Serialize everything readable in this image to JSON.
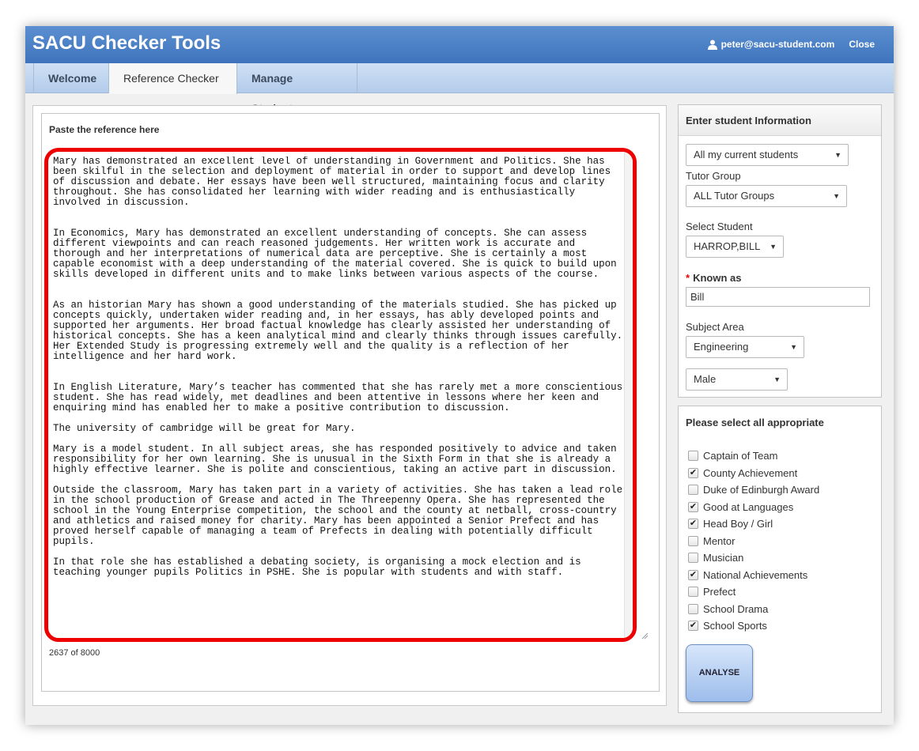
{
  "header": {
    "title": "SACU Checker Tools",
    "user_email": "peter@sacu-student.com",
    "close_label": "Close"
  },
  "tabs": [
    {
      "label": "Welcome",
      "active": false
    },
    {
      "label": "Reference Checker",
      "active": true
    },
    {
      "label": "Manage Students",
      "active": false
    }
  ],
  "reference": {
    "label": "Paste the reference here",
    "text": "Mary has demonstrated an excellent level of understanding in Government and Politics. She has\nbeen skilful in the selection and deployment of material in order to support and develop lines\nof discussion and debate. Her essays have been well structured, maintaining focus and clarity\nthroughout. She has consolidated her learning with wider reading and is enthusiastically\ninvolved in discussion.\n\n\nIn Economics, Mary has demonstrated an excellent understanding of concepts. She can assess\ndifferent viewpoints and can reach reasoned judgements. Her written work is accurate and\nthorough and her interpretations of numerical data are perceptive. She is certainly a most\ncapable economist with a deep understanding of the material covered. She is quick to build upon\nskills developed in different units and to make links between various aspects of the course.\n\n\nAs an historian Mary has shown a good understanding of the materials studied. She has picked up\nconcepts quickly, undertaken wider reading and, in her essays, has ably developed points and\nsupported her arguments. Her broad factual knowledge has clearly assisted her understanding of\nhistorical concepts. She has a keen analytical mind and clearly thinks through issues carefully.\nHer Extended Study is progressing extremely well and the quality is a reflection of her\nintelligence and her hard work.\n\n\nIn English Literature, Mary’s teacher has commented that she has rarely met a more conscientious\nstudent. She has read widely, met deadlines and been attentive in lessons where her keen and\nenquiring mind has enabled her to make a positive contribution to discussion.\n\nThe university of cambridge will be great for Mary.\n\nMary is a model student. In all subject areas, she has responded positively to advice and taken\nresponsibility for her own learning. She is unusual in the Sixth Form in that she is already a\nhighly effective learner. She is polite and conscientious, taking an active part in discussion.\n\nOutside the classroom, Mary has taken part in a variety of activities. She has taken a lead role\nin the school production of Grease and acted in The Threepenny Opera. She has represented the\nschool in the Young Enterprise competition, the school and the county at netball, cross-country\nand athletics and raised money for charity. Mary has been appointed a Senior Prefect and has\nproved herself capable of managing a team of Prefects in dealing with potentially difficult\npupils.\n\nIn that role she has established a debating society, is organising a mock election and is\nteaching younger pupils Politics in PSHE. She is popular with students and with staff.",
    "char_count": "2637 of 8000"
  },
  "student_info": {
    "heading": "Enter student Information",
    "students_select": "All my current students",
    "tutor_group_label": "Tutor Group",
    "tutor_group_select": "ALL Tutor Groups",
    "select_student_label": "Select Student",
    "student_select": "HARROP,BILL",
    "required_mark": "*",
    "known_as_label": "Known as",
    "known_as_value": "Bill",
    "subject_area_label": "Subject Area",
    "subject_select": "Engineering",
    "gender_select": "Male",
    "arrow_glyph": "▼"
  },
  "appropriate": {
    "heading": "Please select all appropriate",
    "check_glyph": "✔",
    "items": [
      {
        "label": "Captain of Team",
        "checked": false
      },
      {
        "label": "County Achievement",
        "checked": true
      },
      {
        "label": "Duke of Edinburgh Award",
        "checked": false
      },
      {
        "label": "Good at Languages",
        "checked": true
      },
      {
        "label": "Head Boy / Girl",
        "checked": true
      },
      {
        "label": "Mentor",
        "checked": false
      },
      {
        "label": "Musician",
        "checked": false
      },
      {
        "label": "National Achievements",
        "checked": true
      },
      {
        "label": "Prefect",
        "checked": false
      },
      {
        "label": "School Drama",
        "checked": false
      },
      {
        "label": "School Sports",
        "checked": true
      }
    ],
    "analyse_label": "ANALYSE"
  },
  "colors": {
    "header": "#4a80c6",
    "highlight_border": "#ee0000",
    "tabbar": "#c1d6ef"
  },
  "icons": {
    "user": "user-icon",
    "dropdown": "chevron-down-icon",
    "checkbox": "checkmark-icon",
    "resize": "resize-grip-icon"
  }
}
